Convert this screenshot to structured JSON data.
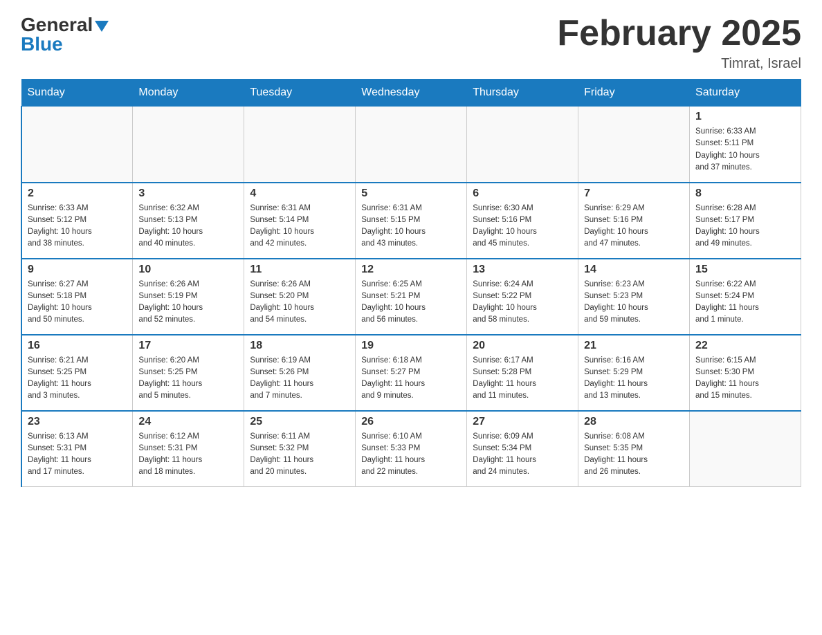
{
  "header": {
    "logo_general": "General",
    "logo_blue": "Blue",
    "title": "February 2025",
    "location": "Timrat, Israel"
  },
  "days_of_week": [
    "Sunday",
    "Monday",
    "Tuesday",
    "Wednesday",
    "Thursday",
    "Friday",
    "Saturday"
  ],
  "weeks": [
    [
      {
        "day": "",
        "info": ""
      },
      {
        "day": "",
        "info": ""
      },
      {
        "day": "",
        "info": ""
      },
      {
        "day": "",
        "info": ""
      },
      {
        "day": "",
        "info": ""
      },
      {
        "day": "",
        "info": ""
      },
      {
        "day": "1",
        "info": "Sunrise: 6:33 AM\nSunset: 5:11 PM\nDaylight: 10 hours\nand 37 minutes."
      }
    ],
    [
      {
        "day": "2",
        "info": "Sunrise: 6:33 AM\nSunset: 5:12 PM\nDaylight: 10 hours\nand 38 minutes."
      },
      {
        "day": "3",
        "info": "Sunrise: 6:32 AM\nSunset: 5:13 PM\nDaylight: 10 hours\nand 40 minutes."
      },
      {
        "day": "4",
        "info": "Sunrise: 6:31 AM\nSunset: 5:14 PM\nDaylight: 10 hours\nand 42 minutes."
      },
      {
        "day": "5",
        "info": "Sunrise: 6:31 AM\nSunset: 5:15 PM\nDaylight: 10 hours\nand 43 minutes."
      },
      {
        "day": "6",
        "info": "Sunrise: 6:30 AM\nSunset: 5:16 PM\nDaylight: 10 hours\nand 45 minutes."
      },
      {
        "day": "7",
        "info": "Sunrise: 6:29 AM\nSunset: 5:16 PM\nDaylight: 10 hours\nand 47 minutes."
      },
      {
        "day": "8",
        "info": "Sunrise: 6:28 AM\nSunset: 5:17 PM\nDaylight: 10 hours\nand 49 minutes."
      }
    ],
    [
      {
        "day": "9",
        "info": "Sunrise: 6:27 AM\nSunset: 5:18 PM\nDaylight: 10 hours\nand 50 minutes."
      },
      {
        "day": "10",
        "info": "Sunrise: 6:26 AM\nSunset: 5:19 PM\nDaylight: 10 hours\nand 52 minutes."
      },
      {
        "day": "11",
        "info": "Sunrise: 6:26 AM\nSunset: 5:20 PM\nDaylight: 10 hours\nand 54 minutes."
      },
      {
        "day": "12",
        "info": "Sunrise: 6:25 AM\nSunset: 5:21 PM\nDaylight: 10 hours\nand 56 minutes."
      },
      {
        "day": "13",
        "info": "Sunrise: 6:24 AM\nSunset: 5:22 PM\nDaylight: 10 hours\nand 58 minutes."
      },
      {
        "day": "14",
        "info": "Sunrise: 6:23 AM\nSunset: 5:23 PM\nDaylight: 10 hours\nand 59 minutes."
      },
      {
        "day": "15",
        "info": "Sunrise: 6:22 AM\nSunset: 5:24 PM\nDaylight: 11 hours\nand 1 minute."
      }
    ],
    [
      {
        "day": "16",
        "info": "Sunrise: 6:21 AM\nSunset: 5:25 PM\nDaylight: 11 hours\nand 3 minutes."
      },
      {
        "day": "17",
        "info": "Sunrise: 6:20 AM\nSunset: 5:25 PM\nDaylight: 11 hours\nand 5 minutes."
      },
      {
        "day": "18",
        "info": "Sunrise: 6:19 AM\nSunset: 5:26 PM\nDaylight: 11 hours\nand 7 minutes."
      },
      {
        "day": "19",
        "info": "Sunrise: 6:18 AM\nSunset: 5:27 PM\nDaylight: 11 hours\nand 9 minutes."
      },
      {
        "day": "20",
        "info": "Sunrise: 6:17 AM\nSunset: 5:28 PM\nDaylight: 11 hours\nand 11 minutes."
      },
      {
        "day": "21",
        "info": "Sunrise: 6:16 AM\nSunset: 5:29 PM\nDaylight: 11 hours\nand 13 minutes."
      },
      {
        "day": "22",
        "info": "Sunrise: 6:15 AM\nSunset: 5:30 PM\nDaylight: 11 hours\nand 15 minutes."
      }
    ],
    [
      {
        "day": "23",
        "info": "Sunrise: 6:13 AM\nSunset: 5:31 PM\nDaylight: 11 hours\nand 17 minutes."
      },
      {
        "day": "24",
        "info": "Sunrise: 6:12 AM\nSunset: 5:31 PM\nDaylight: 11 hours\nand 18 minutes."
      },
      {
        "day": "25",
        "info": "Sunrise: 6:11 AM\nSunset: 5:32 PM\nDaylight: 11 hours\nand 20 minutes."
      },
      {
        "day": "26",
        "info": "Sunrise: 6:10 AM\nSunset: 5:33 PM\nDaylight: 11 hours\nand 22 minutes."
      },
      {
        "day": "27",
        "info": "Sunrise: 6:09 AM\nSunset: 5:34 PM\nDaylight: 11 hours\nand 24 minutes."
      },
      {
        "day": "28",
        "info": "Sunrise: 6:08 AM\nSunset: 5:35 PM\nDaylight: 11 hours\nand 26 minutes."
      },
      {
        "day": "",
        "info": ""
      }
    ]
  ]
}
